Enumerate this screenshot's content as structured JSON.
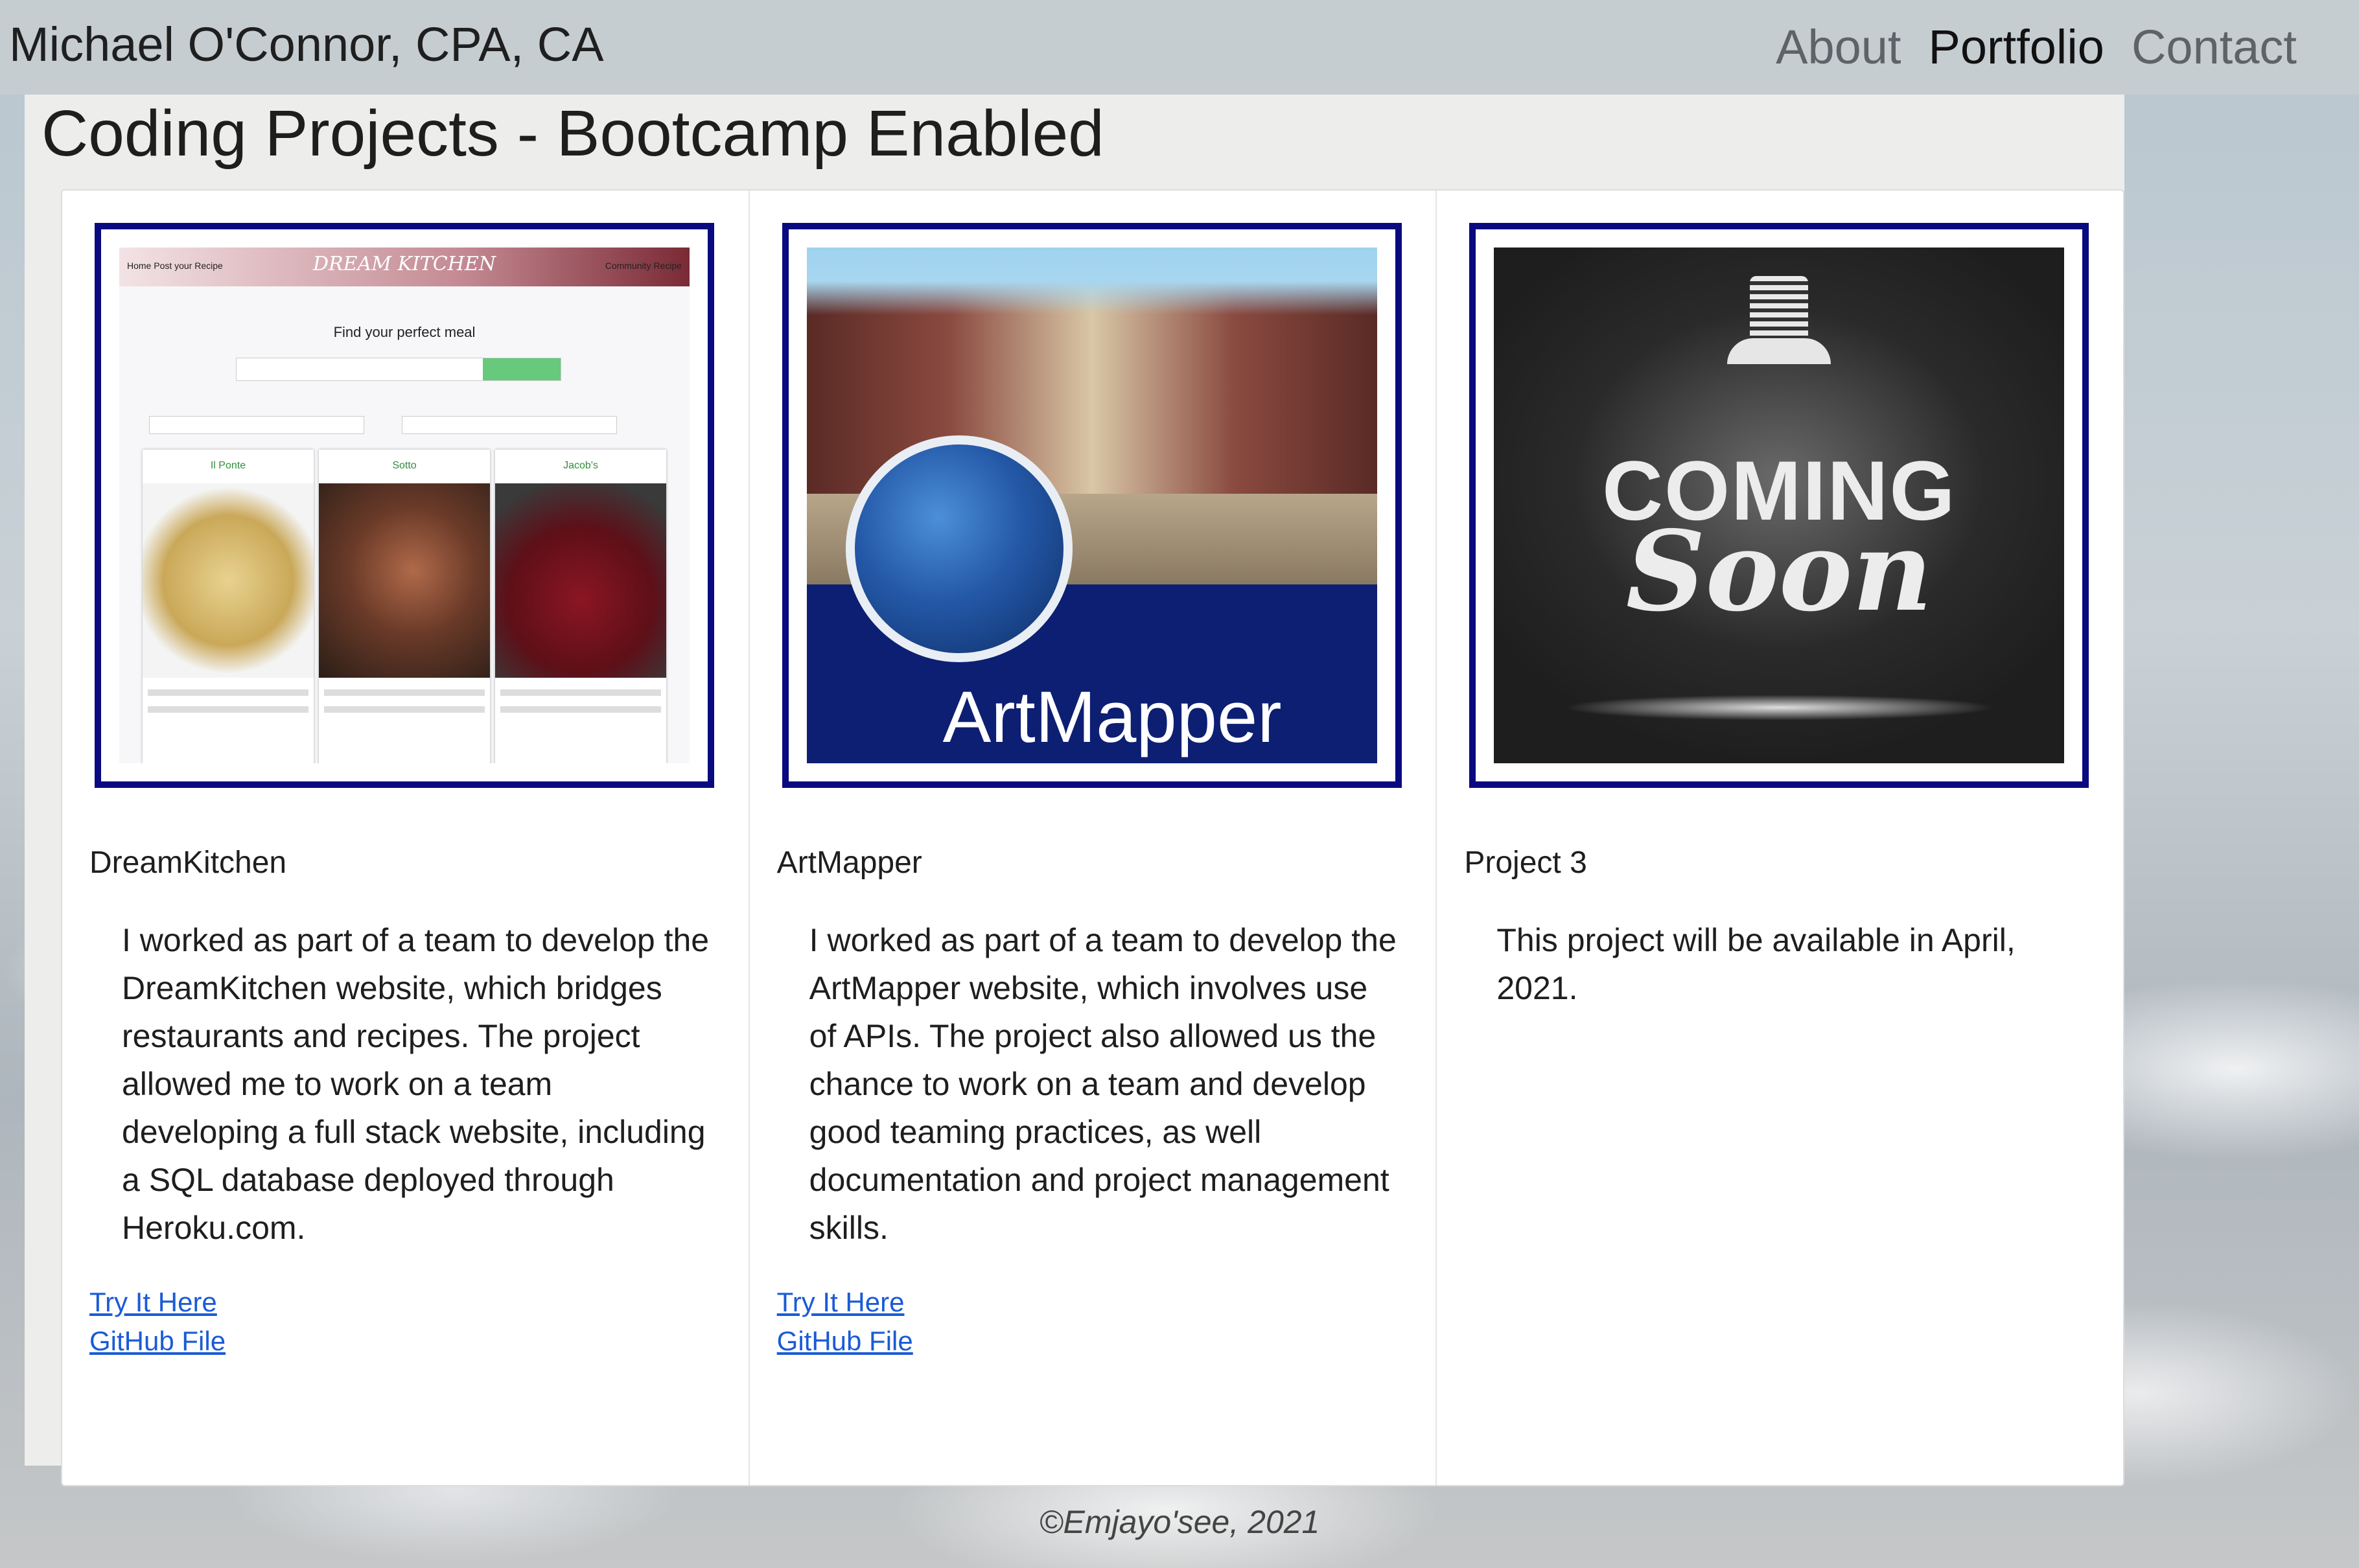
{
  "nav": {
    "brand": "Michael O'Connor, CPA, CA",
    "links": [
      {
        "label": "About",
        "active": false
      },
      {
        "label": "Portfolio",
        "active": true
      },
      {
        "label": "Contact",
        "active": false
      }
    ]
  },
  "page": {
    "title": "Coding Projects - Bootcamp Enabled"
  },
  "cards": [
    {
      "title": "DreamKitchen",
      "text": "I worked as part of a team to develop the DreamKitchen website, which bridges restaurants and recipes. The project allowed me to work on a team developing a full stack website, including a SQL database deployed through Heroku.com.",
      "links": [
        "Try It Here",
        "GitHub File"
      ],
      "image": {
        "brand": "DREAM KITCHEN",
        "left_nav": "Home   Post your Recipe",
        "right_nav": "Community Recipe",
        "heading": "Find your perfect meal",
        "restaurants": [
          "Il Ponte",
          "Sotto",
          "Jacob's"
        ]
      }
    },
    {
      "title": "ArtMapper",
      "text": "I worked as part of a team to develop the ArtMapper website, which involves use of APIs. The project also allowed us the chance to work on a team and develop good teaming practices, as well documentation and project management skills.",
      "links": [
        "Try It Here",
        "GitHub File"
      ],
      "image": {
        "label": "ArtMapper"
      }
    },
    {
      "title": "Project 3",
      "text": "This project will be available in April, 2021.",
      "links": [],
      "image": {
        "line1": "COMING",
        "line2": "Soon"
      }
    }
  ],
  "footer": {
    "text": "©Emjayo'see, 2021"
  },
  "colors": {
    "frame": "#0a0a80",
    "link": "#1a5bd6",
    "navbar": "#c5cdd1",
    "container": "#ededec"
  }
}
